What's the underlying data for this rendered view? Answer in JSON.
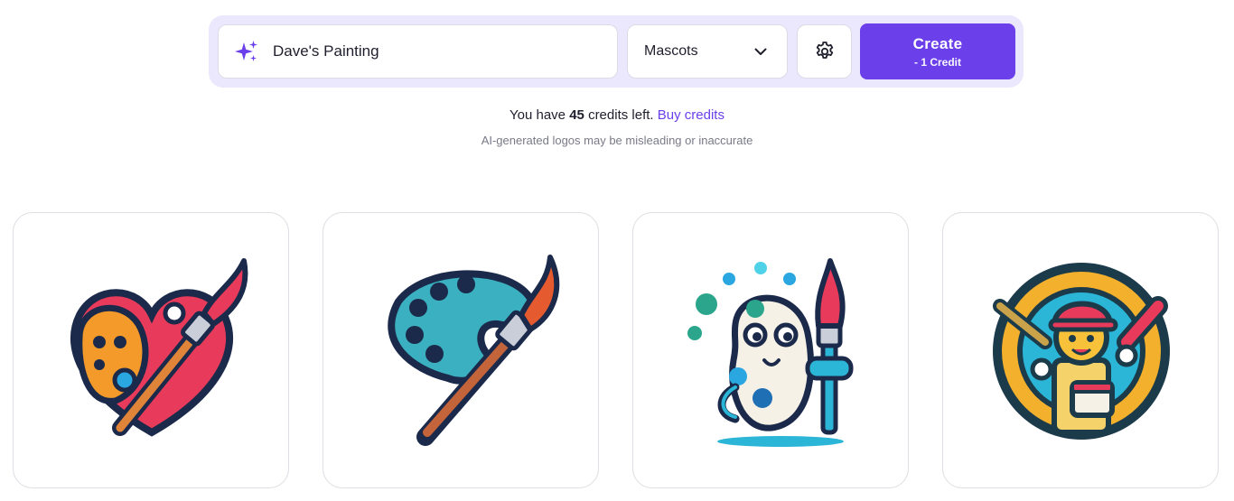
{
  "toolbar": {
    "prompt_value": "Dave's Painting",
    "prompt_icon": "sparkle-icon",
    "style_selected": "Mascots",
    "settings_icon": "gear-icon",
    "create_label": "Create",
    "create_cost": "- 1 Credit",
    "accent_color": "#6b3fea"
  },
  "credits": {
    "prefix": "You have",
    "count": "45",
    "suffix": "credits left.",
    "buy_link": "Buy credits"
  },
  "disclaimer": "AI-generated logos may be misleading or inaccurate",
  "results": [
    {
      "id": 1,
      "icon": "heart-palette-brush-logo"
    },
    {
      "id": 2,
      "icon": "teal-palette-brush-logo"
    },
    {
      "id": 3,
      "icon": "palette-mascot-logo"
    },
    {
      "id": 4,
      "icon": "painter-mascot-badge-logo"
    }
  ]
}
